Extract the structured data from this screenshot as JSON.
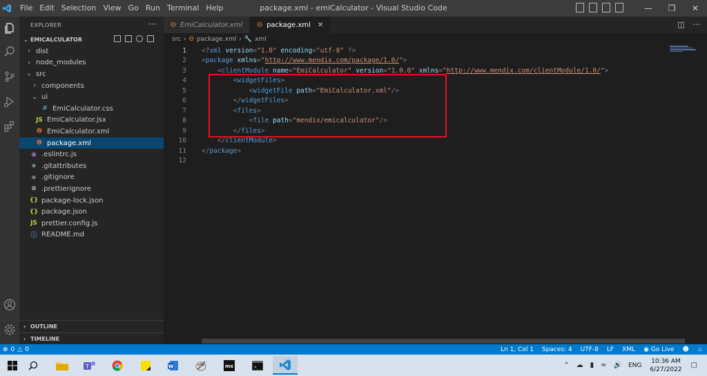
{
  "titlebar": {
    "menu": [
      "File",
      "Edit",
      "Selection",
      "View",
      "Go",
      "Run",
      "Terminal",
      "Help"
    ],
    "title": "package.xml - emiCalculator - Visual Studio Code"
  },
  "sidebar": {
    "header": "EXPLORER",
    "project": "EMICALCULATOR",
    "tree": [
      {
        "label": "dist",
        "type": "folder",
        "open": false,
        "depth": 0
      },
      {
        "label": "node_modules",
        "type": "folder",
        "open": false,
        "depth": 0
      },
      {
        "label": "src",
        "type": "folder",
        "open": true,
        "depth": 0
      },
      {
        "label": "components",
        "type": "folder",
        "open": false,
        "depth": 1
      },
      {
        "label": "ui",
        "type": "folder",
        "open": true,
        "depth": 1
      },
      {
        "label": "EmiCalculator.css",
        "type": "css",
        "depth": 2
      },
      {
        "label": "EmiCalculator.jsx",
        "type": "js",
        "depth": 1
      },
      {
        "label": "EmiCalculator.xml",
        "type": "xml",
        "depth": 1
      },
      {
        "label": "package.xml",
        "type": "xml",
        "depth": 1,
        "selected": true
      },
      {
        "label": ".eslintrc.js",
        "type": "eslint",
        "depth": 0
      },
      {
        "label": ".gitattributes",
        "type": "git",
        "depth": 0
      },
      {
        "label": ".gitignore",
        "type": "git",
        "depth": 0
      },
      {
        "label": ".prettierignore",
        "type": "lines",
        "depth": 0
      },
      {
        "label": "package-lock.json",
        "type": "json",
        "depth": 0
      },
      {
        "label": "package.json",
        "type": "json",
        "depth": 0
      },
      {
        "label": "prettier.config.js",
        "type": "js",
        "depth": 0
      },
      {
        "label": "README.md",
        "type": "info",
        "depth": 0
      }
    ],
    "outline": "OUTLINE",
    "timeline": "TIMELINE"
  },
  "editor": {
    "tabs": [
      {
        "label": "EmiCalculator.xml",
        "active": false
      },
      {
        "label": "package.xml",
        "active": true
      }
    ],
    "breadcrumb": [
      "src",
      "package.xml",
      "xml"
    ],
    "lines": [
      "<?xml version=\"1.0\" encoding=\"utf-8\" ?>",
      "<package xmlns=\"http://www.mendix.com/package/1.0/\">",
      "    <clientModule name=\"EmiCalculator\" version=\"1.0.0\" xmlns=\"http://www.mendix.com/clientModule/1.0/\">",
      "        <widgetFiles>",
      "            <widgetFile path=\"EmiCalculator.xml\"/>",
      "        </widgetFiles>",
      "        <files>",
      "            <file path=\"mendix/emicalculator\"/>",
      "        </files>",
      "    </clientModule>",
      "</package>",
      ""
    ]
  },
  "statusbar": {
    "problems": "0",
    "warnings": "0",
    "position": "Ln 1, Col 1",
    "spaces": "Spaces: 4",
    "encoding": "UTF-8",
    "eol": "LF",
    "language": "XML",
    "golive": "Go Live"
  },
  "taskbar": {
    "lang": "ENG",
    "time": "10:36 AM",
    "date": "6/27/2022"
  },
  "colors": {
    "accent": "#007acc",
    "highlight": "#e81123",
    "selection": "#094771"
  }
}
